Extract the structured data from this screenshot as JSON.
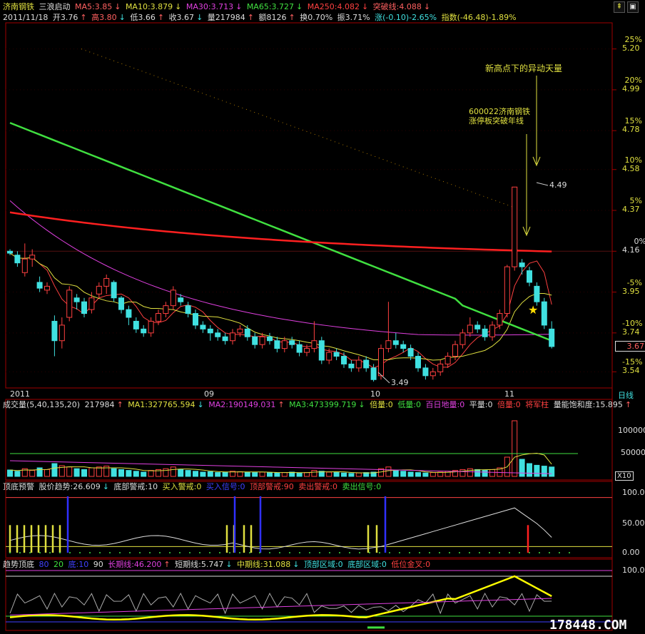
{
  "header": {
    "stock_name": "济南钢铁",
    "indicator": "三浪启动",
    "ma5": "MA5:3.85",
    "ma10": "MA10:3.879",
    "ma30": "MA30:3.713",
    "ma65": "MA65:3.727",
    "ma250": "MA250:4.082",
    "breakout": "突破线:4.088",
    "date": "2011/11/18",
    "open": "开3.76",
    "high": "高3.80",
    "low": "低3.66",
    "close": "收3.67",
    "volume": "量217984",
    "amount": "额8126",
    "turnover": "换0.70%",
    "amplitude": "振3.71%",
    "change": "涨(-0.10)-2.65%",
    "index": "指数(-46.48)-1.89%"
  },
  "annotations": {
    "top_note": "新高点下的异动天量",
    "mid_note_1": "600022济南钢铁",
    "mid_note_2": "涨停板突破年线",
    "high_label": "4.49",
    "low_label": "3.49",
    "current_price": "3.67"
  },
  "price_axis": {
    "labels": [
      {
        "pct": "25%",
        "price": "5.20"
      },
      {
        "pct": "20%",
        "price": "4.99"
      },
      {
        "pct": "15%",
        "price": "4.78"
      },
      {
        "pct": "10%",
        "price": "4.58"
      },
      {
        "pct": "5%",
        "price": "4.37"
      },
      {
        "pct": "0%",
        "price": "4.16"
      },
      {
        "pct": "-5%",
        "price": "3.95"
      },
      {
        "pct": "-10%",
        "price": "3.74"
      },
      {
        "pct": "-15%",
        "price": "3.54"
      }
    ]
  },
  "date_axis": {
    "labels": [
      "2011",
      "09",
      "10",
      "11"
    ],
    "period": "日线"
  },
  "volume_panel": {
    "title": "成交量(5,40,135,20)",
    "value": "217984",
    "ma1": "MA1:327765.594",
    "ma2": "MA2:190149.031",
    "ma3": "MA3:473399.719",
    "bei": "倍量:0",
    "di": "低量:0",
    "bairi": "百日地量:0",
    "ping": "平量:0",
    "beiming": "倍量:0",
    "jiang": "将军柱",
    "sat": "量能饱和度:15.895",
    "axis": [
      "100000",
      "50000"
    ],
    "unit": "X10"
  },
  "signal_panel": {
    "title": "顶底预警",
    "trend": "股价趋势:26.609",
    "bottom_warn": "底部警戒:10",
    "buy_warn": "买入警戒:0",
    "buy_signal": "买入信号:0",
    "top_warn": "顶部警戒:90",
    "sell_warn": "卖出警戒:0",
    "sell_signal": "卖出信号:0",
    "axis": [
      "100.00",
      "50.00",
      "0.00"
    ]
  },
  "trend_panel": {
    "title": "趋势顶底",
    "p1": "80",
    "p2": "20",
    "bottom": "底:10",
    "p3": "90",
    "long": "长期线:46.200",
    "short": "短期线:5.747",
    "mid": "中期线:31.088",
    "top_zone": "顶部区域:0",
    "bottom_zone": "底部区域:0",
    "golden": "低位金叉:0",
    "axis": [
      "100.00"
    ]
  },
  "watermark": "178448.COM",
  "chart_data": {
    "type": "candlestick",
    "title": "济南钢铁",
    "ylim": [
      3.49,
      5.25
    ],
    "candles": [
      [
        4.16,
        4.15,
        4.17,
        4.14
      ],
      [
        4.14,
        4.1,
        4.16,
        4.08
      ],
      [
        4.05,
        4.12,
        4.2,
        4.03
      ],
      [
        4.12,
        4.14,
        4.17,
        4.08
      ],
      [
        4.0,
        3.97,
        4.03,
        3.95
      ],
      [
        3.96,
        3.98,
        4.0,
        3.94
      ],
      [
        3.8,
        3.7,
        3.83,
        3.62
      ],
      [
        3.7,
        3.78,
        3.82,
        3.66
      ],
      [
        3.82,
        3.96,
        3.98,
        3.8
      ],
      [
        3.92,
        3.9,
        3.94,
        3.86
      ],
      [
        3.9,
        3.84,
        3.92,
        3.82
      ],
      [
        3.86,
        3.92,
        3.95,
        3.84
      ],
      [
        3.94,
        3.98,
        4.0,
        3.92
      ],
      [
        3.98,
        4.02,
        4.04,
        3.94
      ],
      [
        4.0,
        3.92,
        4.01,
        3.9
      ],
      [
        3.92,
        3.86,
        3.93,
        3.84
      ],
      [
        3.86,
        3.82,
        3.88,
        3.78
      ],
      [
        3.8,
        3.76,
        3.82,
        3.74
      ],
      [
        3.76,
        3.74,
        3.78,
        3.72
      ],
      [
        3.74,
        3.8,
        3.82,
        3.72
      ],
      [
        3.8,
        3.84,
        3.86,
        3.78
      ],
      [
        3.84,
        3.88,
        3.9,
        3.82
      ],
      [
        3.88,
        3.96,
        3.98,
        3.86
      ],
      [
        3.92,
        3.9,
        3.94,
        3.88
      ],
      [
        3.88,
        3.84,
        3.9,
        3.82
      ],
      [
        3.84,
        3.78,
        3.86,
        3.76
      ],
      [
        3.78,
        3.76,
        3.8,
        3.74
      ],
      [
        3.76,
        3.74,
        3.78,
        3.7
      ],
      [
        3.74,
        3.72,
        3.76,
        3.7
      ],
      [
        3.72,
        3.7,
        3.74,
        3.68
      ],
      [
        3.7,
        3.74,
        3.76,
        3.68
      ],
      [
        3.74,
        3.76,
        3.78,
        3.72
      ],
      [
        3.76,
        3.72,
        3.78,
        3.7
      ],
      [
        3.72,
        3.68,
        3.74,
        3.66
      ],
      [
        3.68,
        3.72,
        3.74,
        3.66
      ],
      [
        3.72,
        3.7,
        3.74,
        3.68
      ],
      [
        3.7,
        3.66,
        3.72,
        3.64
      ],
      [
        3.66,
        3.7,
        3.72,
        3.64
      ],
      [
        3.7,
        3.68,
        3.72,
        3.66
      ],
      [
        3.68,
        3.64,
        3.7,
        3.62
      ],
      [
        3.64,
        3.66,
        3.68,
        3.62
      ],
      [
        3.66,
        3.7,
        3.8,
        3.64
      ],
      [
        3.7,
        3.6,
        3.72,
        3.58
      ],
      [
        3.6,
        3.64,
        3.66,
        3.58
      ],
      [
        3.64,
        3.62,
        3.66,
        3.6
      ],
      [
        3.62,
        3.58,
        3.64,
        3.56
      ],
      [
        3.58,
        3.56,
        3.6,
        3.54
      ],
      [
        3.56,
        3.6,
        3.62,
        3.54
      ],
      [
        3.6,
        3.56,
        3.62,
        3.54
      ],
      [
        3.56,
        3.5,
        3.58,
        3.49
      ],
      [
        3.52,
        3.66,
        3.68,
        3.5
      ],
      [
        3.66,
        3.7,
        3.9,
        3.64
      ],
      [
        3.7,
        3.68,
        3.74,
        3.66
      ],
      [
        3.68,
        3.66,
        3.7,
        3.64
      ],
      [
        3.66,
        3.62,
        3.68,
        3.6
      ],
      [
        3.62,
        3.56,
        3.64,
        3.54
      ],
      [
        3.56,
        3.52,
        3.58,
        3.5
      ],
      [
        3.52,
        3.54,
        3.56,
        3.5
      ],
      [
        3.54,
        3.58,
        3.6,
        3.52
      ],
      [
        3.58,
        3.62,
        3.64,
        3.56
      ],
      [
        3.62,
        3.68,
        3.7,
        3.6
      ],
      [
        3.68,
        3.74,
        3.76,
        3.66
      ],
      [
        3.74,
        3.78,
        3.82,
        3.72
      ],
      [
        3.78,
        3.76,
        3.8,
        3.74
      ],
      [
        3.76,
        3.72,
        3.78,
        3.7
      ],
      [
        3.72,
        3.78,
        3.8,
        3.7
      ],
      [
        3.78,
        3.84,
        3.86,
        3.76
      ],
      [
        3.84,
        4.08,
        4.09,
        3.82
      ],
      [
        4.08,
        4.49,
        4.49,
        4.06
      ],
      [
        4.1,
        4.08,
        4.12,
        4.04
      ],
      [
        4.06,
        4.0,
        4.08,
        3.98
      ],
      [
        3.98,
        3.9,
        4.0,
        3.88
      ],
      [
        3.9,
        3.78,
        3.92,
        3.76
      ],
      [
        3.76,
        3.67,
        3.8,
        3.66
      ]
    ],
    "volume": [
      15,
      12,
      18,
      14,
      20,
      16,
      30,
      25,
      22,
      18,
      16,
      20,
      22,
      24,
      18,
      16,
      14,
      12,
      10,
      14,
      16,
      18,
      22,
      16,
      14,
      12,
      10,
      11,
      9,
      10,
      12,
      11,
      10,
      9,
      10,
      9,
      8,
      9,
      10,
      8,
      9,
      14,
      12,
      10,
      9,
      8,
      7,
      8,
      9,
      10,
      18,
      22,
      14,
      12,
      10,
      9,
      8,
      9,
      10,
      12,
      14,
      16,
      18,
      16,
      14,
      16,
      20,
      45,
      130,
      40,
      30,
      26,
      24,
      22
    ]
  }
}
